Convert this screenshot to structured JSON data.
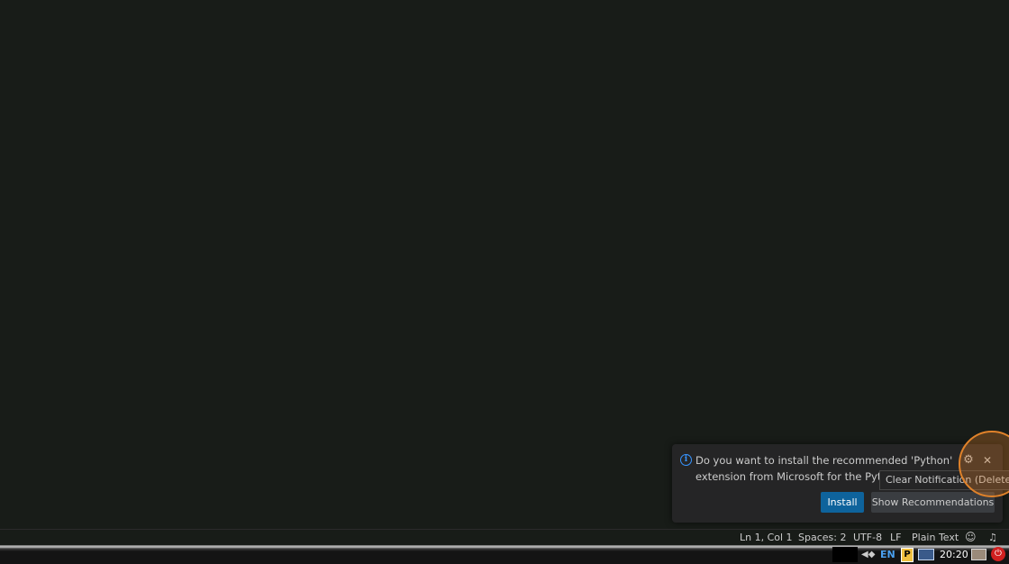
{
  "notification": {
    "info_icon": "info-icon",
    "message_line1": "Do you want to install the recommended 'Python'",
    "message_line2": "extension from Microsoft for the Python",
    "gear_icon": "gear-icon",
    "close_icon": "close-icon",
    "install_label": "Install",
    "show_recommendations_label": "Show Recommendations",
    "tooltip": "Clear Notification (Delete)"
  },
  "statusbar": {
    "position": "Ln 1, Col 1",
    "spaces": "Spaces: 2",
    "encoding": "UTF-8",
    "eol": "LF",
    "language": "Plain Text",
    "feedback_icon": "copilot-icon",
    "bell_icon": "bell-icon"
  },
  "taskbar": {
    "keyboard_layout": "EN",
    "app_badge": "P",
    "clock": "20:20"
  },
  "colors": {
    "accent": "#0e639c",
    "info": "#3794ff",
    "highlight": "#e0822a"
  }
}
